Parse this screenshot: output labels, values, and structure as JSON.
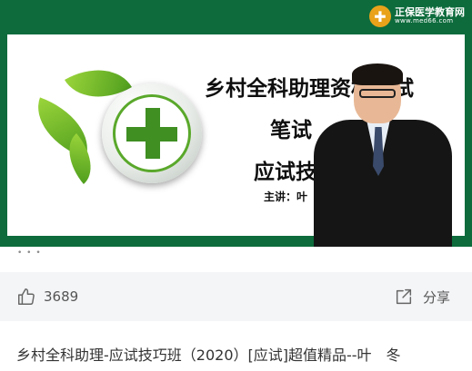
{
  "video": {
    "logo": {
      "name": "正保医学教育网",
      "url": "www.med66.com"
    },
    "slide": {
      "title_line1": "乡村全科助理资格考试",
      "title_line2": "笔试",
      "title_line3": "应试技巧",
      "lecturer": "主讲：叶"
    }
  },
  "progress": {
    "indicator": "• • •"
  },
  "actions": {
    "like_count": "3689",
    "share_label": "分享"
  },
  "description": "乡村全科助理-应试技巧班（2020）[应试]超值精品--叶　冬",
  "colors": {
    "video_bg": "#0d6b3c",
    "action_bar_bg": "#f4f5f7",
    "accent_green": "#3f8f22"
  }
}
